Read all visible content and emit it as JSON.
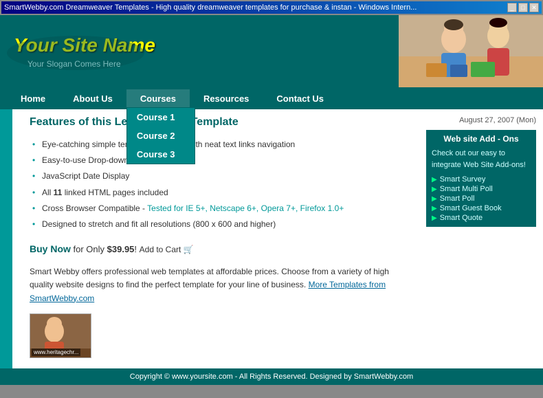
{
  "browser": {
    "title": "SmartWebby.com Dreamweaver Templates - High quality dreamweaver templates for purchase & instan - Windows Intern...",
    "minimize": "_",
    "maximize": "□",
    "close": "✕"
  },
  "header": {
    "site_name": "Your Site Name",
    "slogan": "Your Slogan Comes Here"
  },
  "nav": {
    "items": [
      "Home",
      "About Us",
      "Courses",
      "Resources",
      "Contact Us"
    ],
    "dropdown": {
      "trigger": "Courses",
      "items": [
        "Course 1",
        "Course 2",
        "Course 3"
      ]
    }
  },
  "content": {
    "date": "August 27, 2007 (Mon)",
    "page_title": "Features of this Learning/Kids Template",
    "features": [
      "Eye-catching simple template designed with neat text links navigation",
      "Easy-to-use Drop-down Menus",
      "JavaScript Date Display",
      "All 11 linked HTML pages included",
      "Cross Browser Compatible - Tested for IE 5+, Netscape 6+, Opera 7+, Firefox 1.0+",
      "Designed to stretch and fit all resolutions (800 x 600 and higher)"
    ],
    "feature_5_main": "Cross Browser Compatible - ",
    "feature_5_link": "Tested for IE 5+, Netscape 6+, Opera 7+, Firefox 1.0+",
    "buy_text": "Buy Now",
    "price_text": "for Only ",
    "price": "$39.95",
    "add_cart": "Add to Cart",
    "description": "Smart Webby offers professional web templates at affordable prices. Choose from a variety of high quality website designs to find the perfect template for your line of business.",
    "more_link": "More Templates from SmartWebby.com",
    "thumb_label": "www.heritagechr..."
  },
  "sidebar": {
    "box_title": "Web site Add - Ons",
    "box_text": "Check out our easy to integrate Web Site Add-ons!",
    "links": [
      "Smart Survey",
      "Smart Multi Poll",
      "Smart Poll",
      "Smart Guest Book",
      "Smart Quote"
    ]
  },
  "footer": {
    "text": "Copyright © www.yoursite.com - All Rights Reserved. Designed by SmartWebby.com"
  }
}
